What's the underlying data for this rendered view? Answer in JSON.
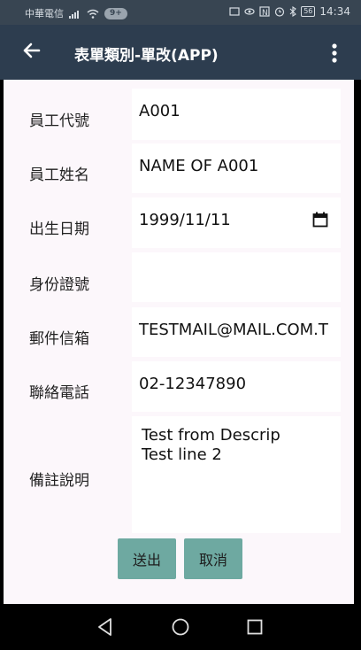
{
  "status_bar": {
    "carrier": "中華電信",
    "badge": "9+",
    "battery": "56",
    "time": "14:34"
  },
  "app_bar": {
    "title": "表單類別-單改(APP)"
  },
  "form": {
    "fields": [
      {
        "label": "員工代號",
        "value": ""
      },
      {
        "label": "員工姓名",
        "value": ""
      },
      {
        "label": "出生日期",
        "value": ""
      },
      {
        "label": "身份證號",
        "value": ""
      },
      {
        "label": "郵件信箱",
        "value": ""
      },
      {
        "label": "聯絡電話",
        "value": ""
      },
      {
        "label": "備註說明",
        "value": ""
      }
    ],
    "values": {
      "emp_id": "A001",
      "emp_name": "NAME OF A001",
      "birth_date": "1999/11/11",
      "id_number": "",
      "email": "TESTMAIL@MAIL.COM.T",
      "phone": "02-12347890",
      "notes": "Test from Descrip\nTest line 2"
    }
  },
  "buttons": {
    "submit": "送出",
    "cancel": "取消"
  }
}
